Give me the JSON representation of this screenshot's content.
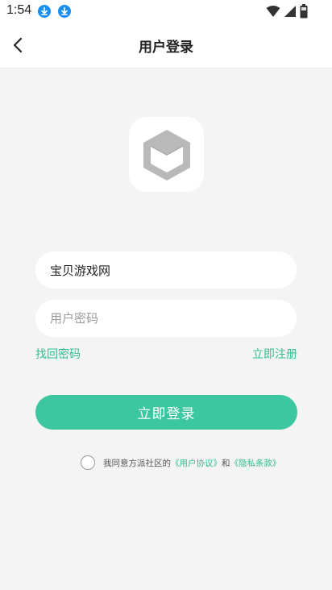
{
  "status_bar": {
    "time": "1:54"
  },
  "header": {
    "title": "用户登录",
    "back_icon": "chevron-left-icon"
  },
  "form": {
    "username_value": "宝贝游戏网",
    "password_placeholder": "用户密码"
  },
  "links": {
    "forgot_password": "找回密码",
    "register": "立即注册"
  },
  "login_button": "立即登录",
  "agreement": {
    "prefix": "我同意方派社区的",
    "user_agreement": "《用户协议》",
    "and": "和",
    "privacy_policy": "《隐私条款》",
    "checked": false
  },
  "colors": {
    "accent": "#3cc7a1",
    "link": "#2fbf8c",
    "background": "#f4f4f4",
    "download_icon": "#1a8ff0"
  },
  "icons": {
    "status_left": [
      "download-icon",
      "download-icon"
    ],
    "status_right": [
      "wifi-icon",
      "signal-icon",
      "battery-icon"
    ],
    "logo": "cube-logo-icon"
  }
}
